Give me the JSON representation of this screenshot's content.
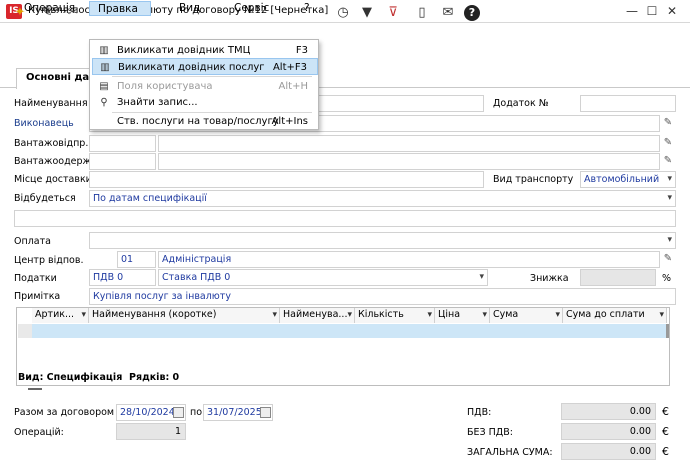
{
  "window": {
    "title": "Купівля послуг за інвалюту по договору №12 [Чернетка]",
    "logo_text": "IS"
  },
  "menu": {
    "items": [
      "Операція",
      "Правка",
      "Вид",
      "Сервіс",
      "?"
    ]
  },
  "dropdown": {
    "items": [
      {
        "icon": "book-icon",
        "label": "Викликати довідник ТМЦ",
        "shortcut": "F3"
      },
      {
        "icon": "book-icon",
        "label": "Викликати довідник послуг",
        "shortcut": "Alt+F3"
      },
      {
        "icon": "user-fields-icon",
        "label": "Поля користувача",
        "shortcut": "Alt+H"
      },
      {
        "icon": "search-icon",
        "label": "Знайти запис...",
        "shortcut": ""
      },
      {
        "icon": "",
        "label": "Ств. послуги на товар/послугу",
        "shortcut": "Alt+Ins"
      }
    ]
  },
  "tabs": {
    "main": "Основні дані"
  },
  "form": {
    "name_label": "Найменування",
    "addendum_label": "Додаток №",
    "executor_label": "Виконавець",
    "shipper_label": "Вантажовідпр.",
    "consignee_label": "Вантажоодерж.",
    "delivery_label": "Місце доставки",
    "transport_label": "Вид транспорту",
    "transport_value": "Автомобільний",
    "occurs_label": "Відбудеться",
    "occurs_value": "По датам специфікації",
    "payment_label": "Оплата",
    "center_label": "Центр відпов.",
    "center_code": "01",
    "center_name": "Адміністрація",
    "taxes_label": "Податки",
    "tax_code": "ПДВ  0",
    "tax_rate": "Ставка ПДВ 0",
    "discount_label": "Знижка",
    "percent": "%",
    "note_label": "Примітка",
    "note_value": "Купівля послуг за інвалюту"
  },
  "table": {
    "columns": [
      "Артик...",
      "Найменування (коротке)",
      "Найменува...",
      "Кількість",
      "Ціна",
      "Сума",
      "Сума до сплати"
    ],
    "view_label": "Вид: Специфікація",
    "rows_label": "Рядків: 0"
  },
  "totals": {
    "contract_label": "Разом за договором з",
    "date_from": "28/10/2024",
    "to_label": "по",
    "date_to": "31/07/2025",
    "ops_label": "Операцій:",
    "ops_value": "1",
    "vat_label": "ПДВ:",
    "vat_value": "0.00",
    "novat_label": "БЕЗ ПДВ:",
    "novat_value": "0.00",
    "total_label": "ЗАГАЛЬНА СУМА:",
    "total_value": "0.00",
    "currency": "€"
  },
  "colors": {
    "selection": "#cce4f7",
    "accent": "#1f3aa0",
    "logo": "#d9262c"
  }
}
